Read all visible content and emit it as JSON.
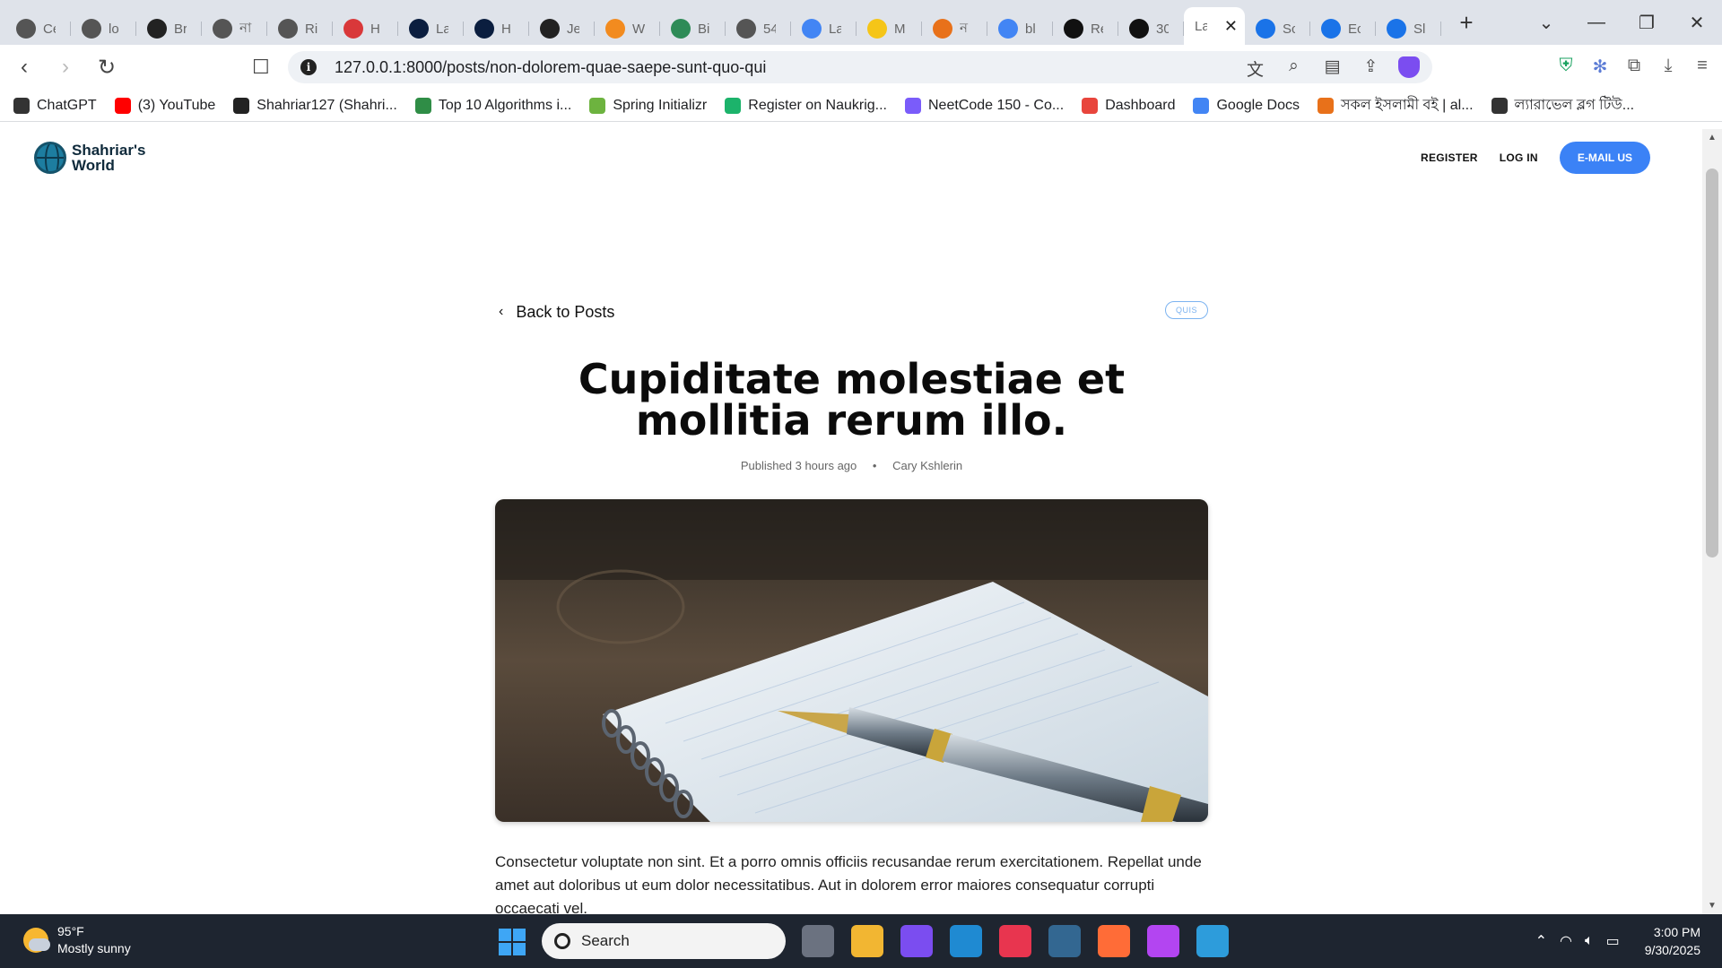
{
  "browser": {
    "tabs": [
      {
        "label": "Ce",
        "icon": "openai-icon",
        "color": "#555555"
      },
      {
        "label": "lo",
        "icon": "openai-icon",
        "color": "#555555"
      },
      {
        "label": "Br",
        "icon": "github-icon",
        "color": "#222222"
      },
      {
        "label": "না",
        "icon": "openai-icon",
        "color": "#555555"
      },
      {
        "label": "Ri",
        "icon": "openai-icon",
        "color": "#555555"
      },
      {
        "label": "H",
        "icon": "nsu-icon",
        "color": "#d9383a"
      },
      {
        "label": "La",
        "icon": "a-icon",
        "color": "#0b1e3f"
      },
      {
        "label": "H",
        "icon": "a-icon",
        "color": "#0b1e3f"
      },
      {
        "label": "Je",
        "icon": "github-icon",
        "color": "#222222"
      },
      {
        "label": "W",
        "icon": "diamond-icon",
        "color": "#f28b1f"
      },
      {
        "label": "Bi",
        "icon": "translate-icon",
        "color": "#2e8b57"
      },
      {
        "label": "54",
        "icon": "globe-icon",
        "color": "#555555"
      },
      {
        "label": "La",
        "icon": "doc-icon",
        "color": "#4285f4"
      },
      {
        "label": "M",
        "icon": "mail-icon",
        "color": "#f5c518"
      },
      {
        "label": "ন",
        "icon": "a-orange-icon",
        "color": "#e8711a"
      },
      {
        "label": "bl",
        "icon": "google-icon",
        "color": "#4285f4"
      },
      {
        "label": "Re",
        "icon": "bank-icon",
        "color": "#111111"
      },
      {
        "label": "30",
        "icon": "is-icon",
        "color": "#111111"
      },
      {
        "label": "La",
        "icon": "",
        "color": "",
        "active": true
      },
      {
        "label": "Sc",
        "icon": "forms-icon",
        "color": "#1a73e8"
      },
      {
        "label": "Ec",
        "icon": "forms-icon",
        "color": "#1a73e8"
      },
      {
        "label": "Sl",
        "icon": "forms-icon",
        "color": "#1a73e8"
      }
    ],
    "new_tab": "+",
    "url": "127.0.0.1:8000/posts/non-dolorem-quae-saepe-sunt-quo-qui",
    "bookmarks": [
      {
        "label": "ChatGPT",
        "icon": "openai-icon",
        "color": "#333333"
      },
      {
        "label": "(3) YouTube",
        "icon": "youtube-icon",
        "color": "#ff0000"
      },
      {
        "label": "Shahriar127 (Shahri...",
        "icon": "github-icon",
        "color": "#222222"
      },
      {
        "label": "Top 10 Algorithms i...",
        "icon": "gfg-icon",
        "color": "#2f8d46"
      },
      {
        "label": "Spring Initializr",
        "icon": "spring-icon",
        "color": "#6db33f"
      },
      {
        "label": "Register on Naukrig...",
        "icon": "naukri-icon",
        "color": "#1cb36b"
      },
      {
        "label": "NeetCode 150 - Co...",
        "icon": "rocket-icon",
        "color": "#7a5cfa"
      },
      {
        "label": "Dashboard",
        "icon": "dashboard-icon",
        "color": "#e8453c"
      },
      {
        "label": "Google Docs",
        "icon": "doc-icon",
        "color": "#4285f4"
      },
      {
        "label": "সকল ইসলামী বই | al...",
        "icon": "a-orange-icon",
        "color": "#e8711a"
      },
      {
        "label": "ল্যারাভেল ব্লগ টিউ...",
        "icon": "openai-icon",
        "color": "#333333"
      }
    ]
  },
  "site": {
    "logo_line1": "Shahriar's",
    "logo_line2": "World",
    "nav": {
      "register": "REGISTER",
      "login": "LOG IN",
      "email": "E-MAIL US"
    }
  },
  "post": {
    "back_label": "Back to Posts",
    "tag": "QUIS",
    "title": "Cupiditate molestiae et mollitia rerum illo.",
    "published": "Published 3 hours ago",
    "separator": "•",
    "author": "Cary Kshlerin",
    "body": "Consectetur voluptate non sint. Et a porro omnis officiis recusandae rerum exercitationem. Repellat unde amet aut doloribus ut eum dolor necessitatibus. Aut in dolorem error maiores consequatur corrupti occaecati vel."
  },
  "taskbar": {
    "temperature": "95°F",
    "weather": "Mostly sunny",
    "search_placeholder": "Search",
    "time": "3:00 PM",
    "date": "9/30/2025",
    "apps": [
      {
        "name": "task-view",
        "color": "#6b7280"
      },
      {
        "name": "file-explorer",
        "color": "#f2b632"
      },
      {
        "name": "brave-vpn",
        "color": "#7b4df0"
      },
      {
        "name": "vscode",
        "color": "#1f8ad2"
      },
      {
        "name": "intellij",
        "color": "#e8354f"
      },
      {
        "name": "postgres",
        "color": "#336791"
      },
      {
        "name": "postman",
        "color": "#ff6c37"
      },
      {
        "name": "phpstorm",
        "color": "#b345f1"
      },
      {
        "name": "photos",
        "color": "#2d9cdb"
      }
    ]
  },
  "colors": {
    "accent": "#3b82f6",
    "tag": "#7cb3f0"
  }
}
